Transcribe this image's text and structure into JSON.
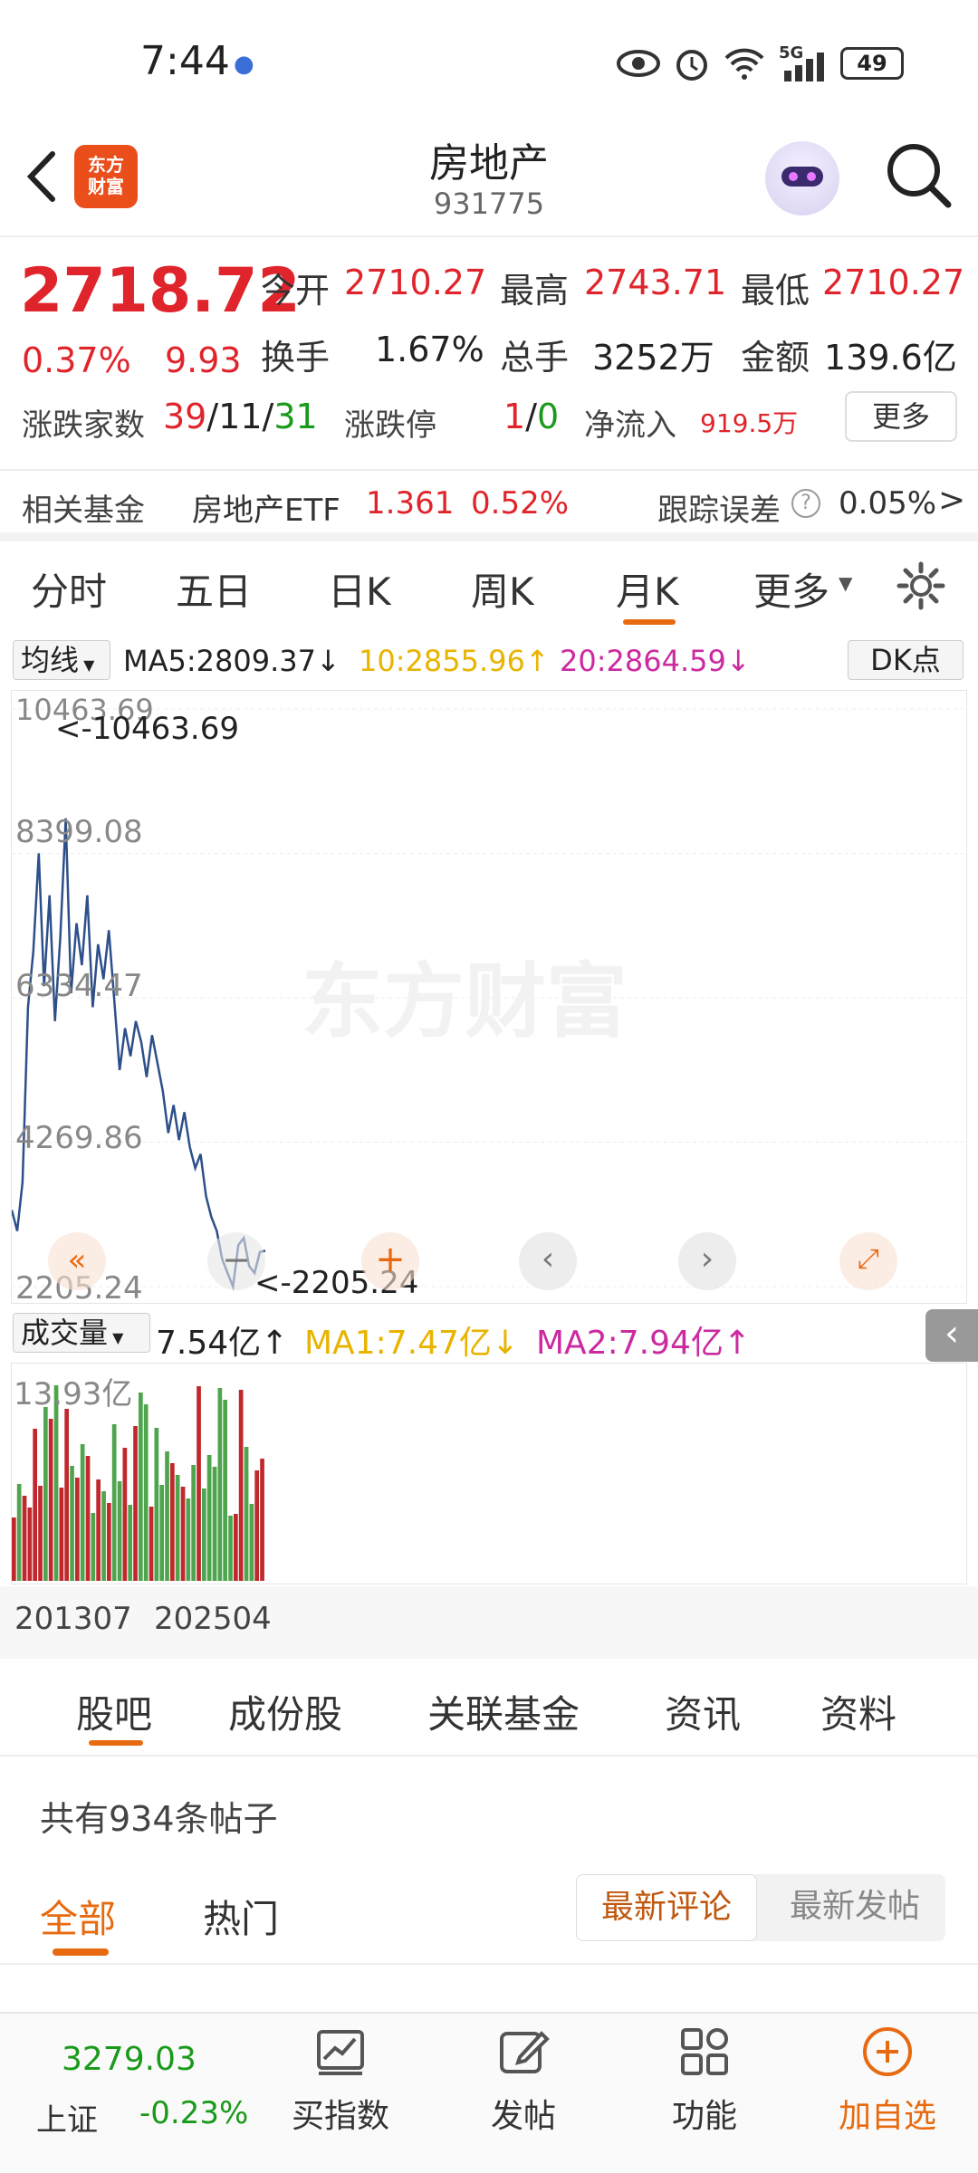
{
  "status_bar": {
    "time": "7:44",
    "battery": "49",
    "network": "5G"
  },
  "header": {
    "logo_text_1": "东方",
    "logo_text_2": "财富",
    "title": "房地产",
    "code": "931775"
  },
  "quote": {
    "price": "2718.72",
    "change_pct": "0.37%",
    "change_val": "9.93",
    "open_label": "今开",
    "open": "2710.27",
    "high_label": "最高",
    "high": "2743.71",
    "low_label": "最低",
    "low": "2710.27",
    "turnover_label": "换手",
    "turnover": "1.67%",
    "volume_label": "总手",
    "volume": "3252万",
    "amount_label": "金额",
    "amount": "139.6亿",
    "breadth_label": "涨跌家数",
    "breadth_up": "39",
    "breadth_flat": "11",
    "breadth_down": "31",
    "limit_label": "涨跌停",
    "limit_up": "1",
    "limit_down": "0",
    "netflow_label": "净流入",
    "netflow": "919.5万",
    "more_label": "更多",
    "fund_label": "相关基金",
    "fund_name": "房地产ETF",
    "fund_price": "1.361",
    "fund_pct": "0.52%",
    "tracking_label": "跟踪误差",
    "tracking_val": "0.05%"
  },
  "k_tabs": [
    "分时",
    "五日",
    "日K",
    "周K",
    "月K",
    "更多"
  ],
  "active_tab": "月K",
  "ma_row": {
    "selector": "均线",
    "ma5": "MA5:2809.37",
    "ma10": "10:2855.96",
    "ma20": "20:2864.59",
    "dk": "DK点"
  },
  "chart_main": {
    "y_labels": [
      "10463.69",
      "8399.08",
      "6334.47",
      "4269.86",
      "2205.24"
    ],
    "max_mark": "<-10463.69",
    "min_mark": "<-2205.24",
    "watermark": "东方财富"
  },
  "vol_row": {
    "selector": "成交量",
    "vol": "7.54亿",
    "ma1": "MA1:7.47亿",
    "ma2": "MA2:7.94亿",
    "y_max": "13.93亿"
  },
  "dates": [
    "201307",
    "202504"
  ],
  "chart_data": {
    "type": "line",
    "series": [
      {
        "values": [
          3300,
          3000,
          3700,
          6200,
          7000,
          8400,
          6500,
          7800,
          6000,
          7200,
          8900,
          6400,
          7400,
          6800,
          7800,
          6200,
          7100,
          6600,
          7300,
          6300,
          5300,
          5900,
          5500,
          6000,
          5700,
          5200,
          5800,
          5400,
          5000,
          4400,
          4800,
          4300,
          4700,
          4200,
          3900,
          4100,
          3500,
          3200,
          3000,
          2600,
          2400,
          2205,
          2800,
          2900,
          2500,
          2400,
          2700,
          2718
        ]
      }
    ],
    "ylim": [
      2205.24,
      10463.69
    ]
  },
  "sub_tabs": [
    "股吧",
    "成份股",
    "关联基金",
    "资讯",
    "资料"
  ],
  "posts_count": "共有934条帖子",
  "filter": {
    "all": "全部",
    "hot": "热门",
    "latest_comment": "最新评论",
    "latest_post": "最新发帖"
  },
  "bottom_bar": {
    "index_value": "3279.03",
    "index_name": "上证",
    "index_pct": "-0.23%",
    "buy_index": "买指数",
    "post": "发帖",
    "function": "功能",
    "add_watch": "加自选"
  }
}
